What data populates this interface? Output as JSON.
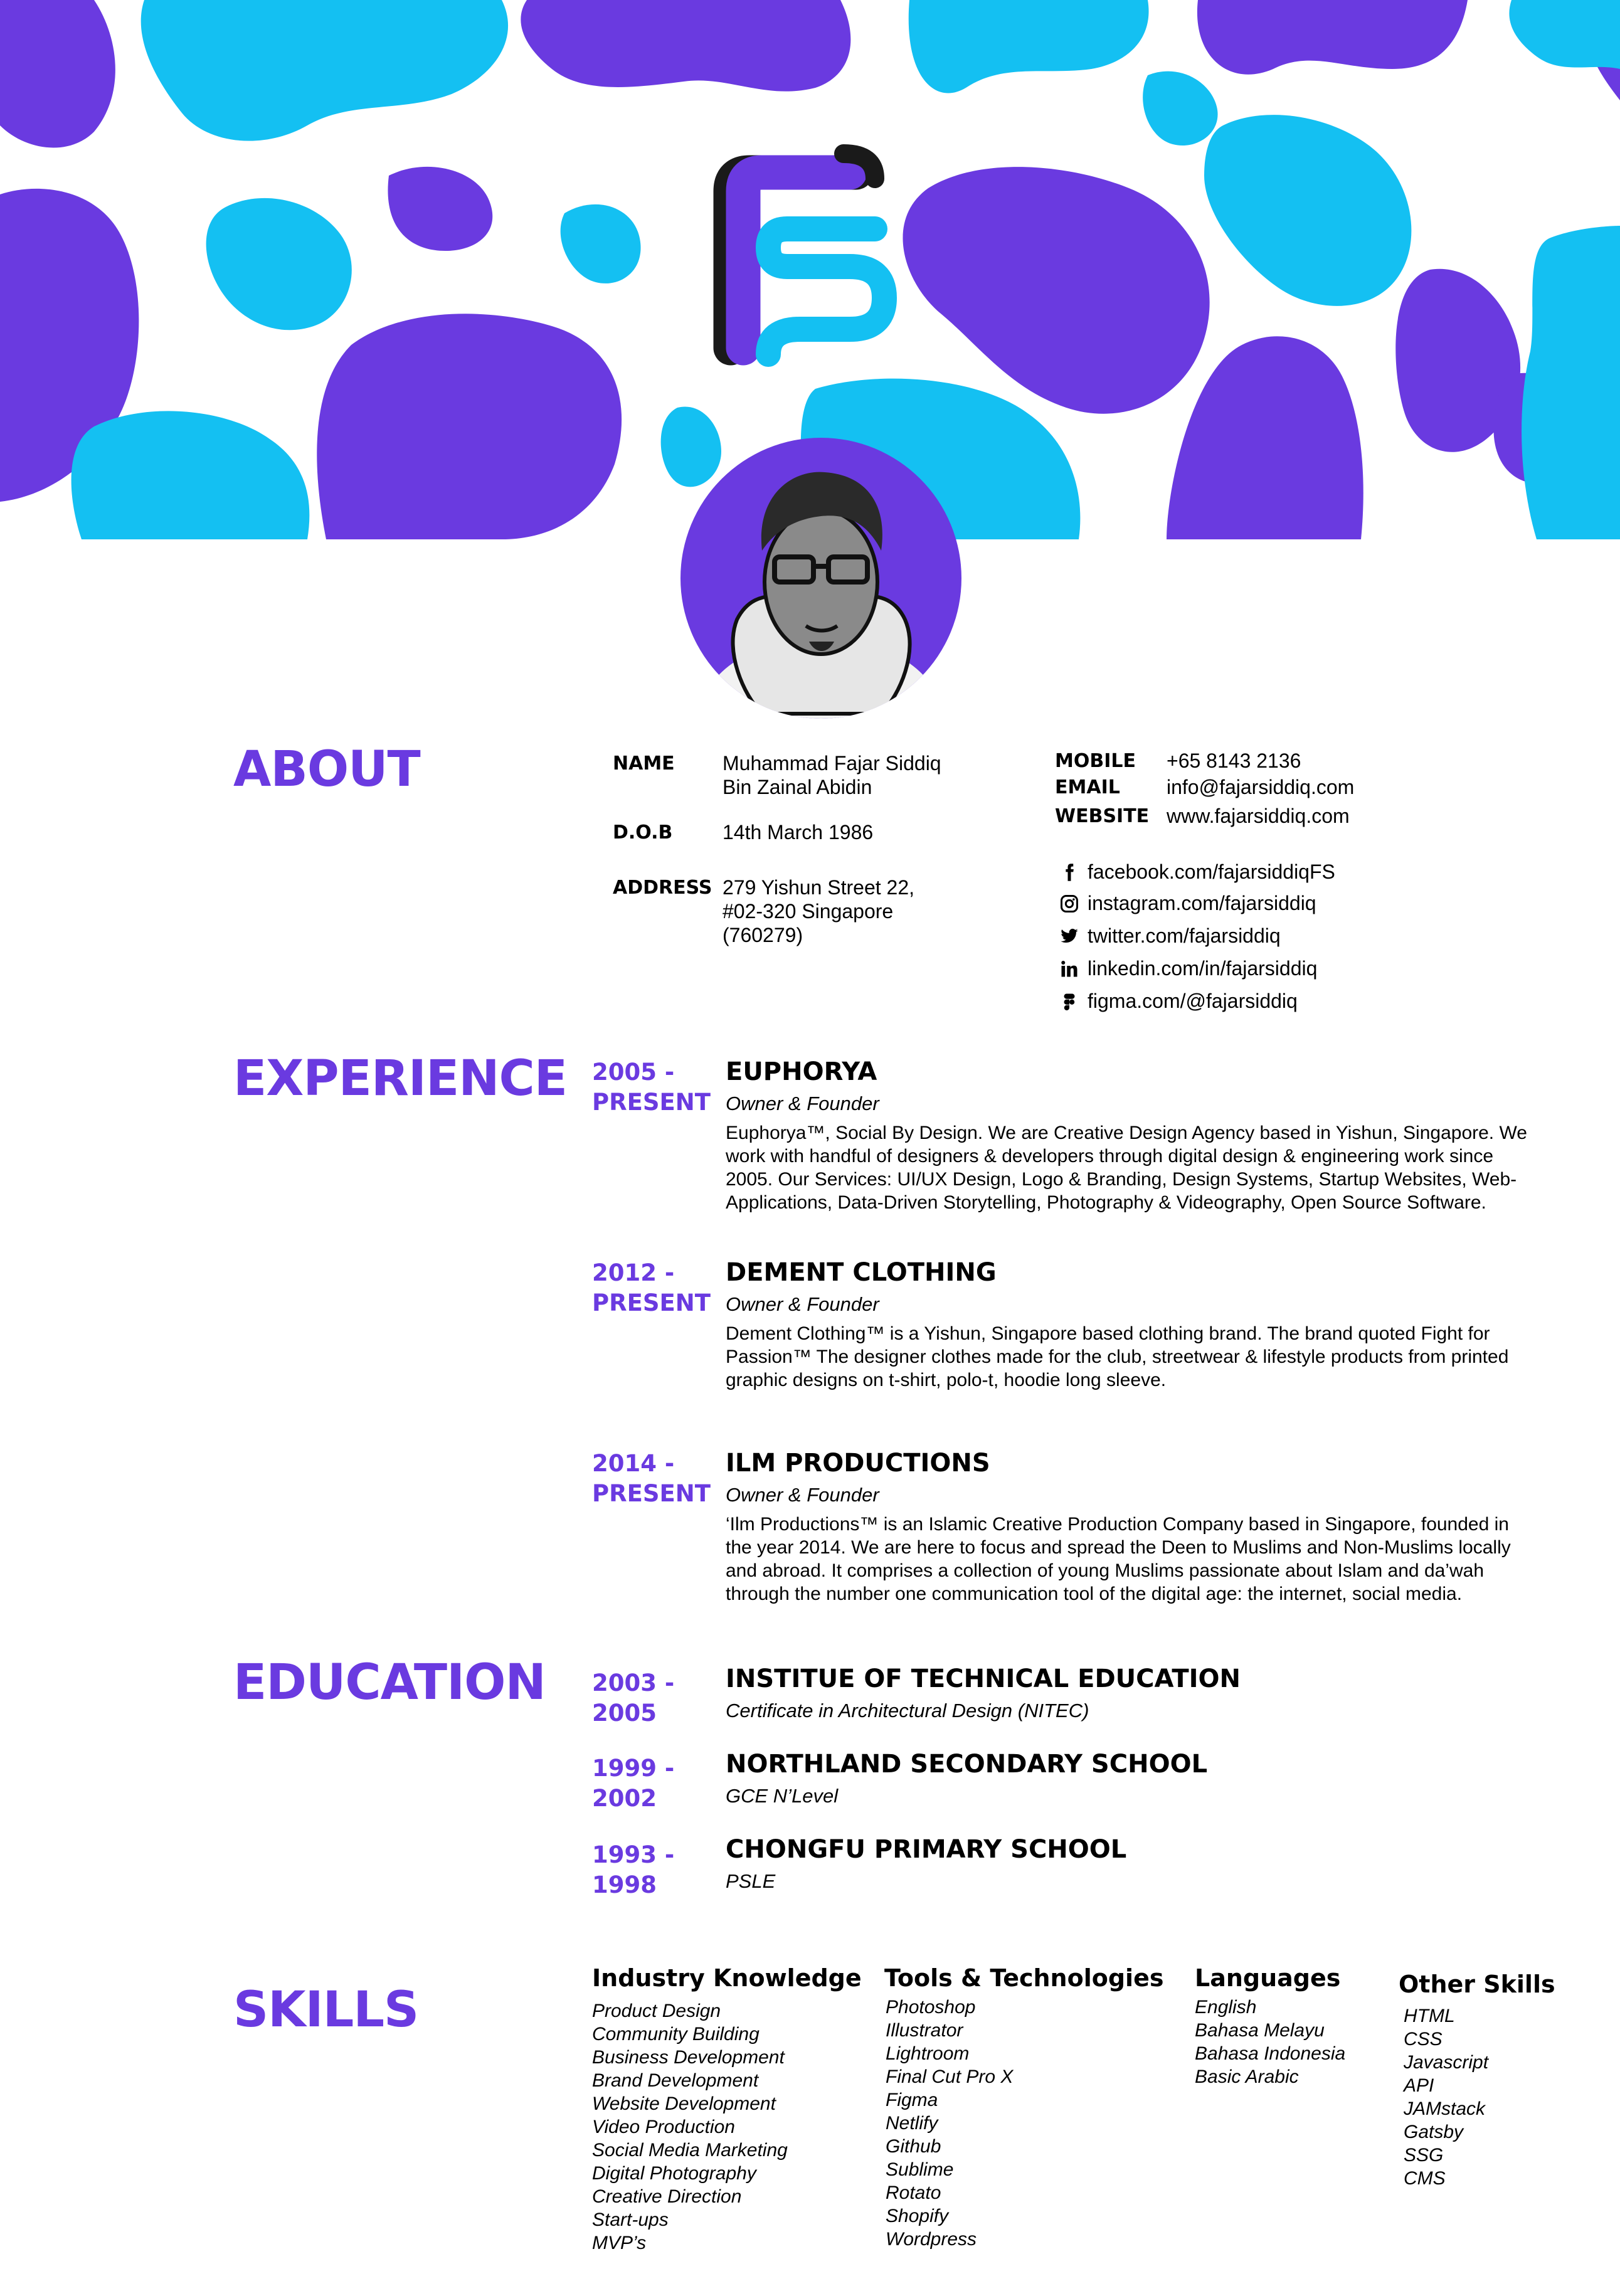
{
  "colors": {
    "purple": "#6a3ae0",
    "cyan": "#14c0f2",
    "text": "#000000"
  },
  "avatar": {
    "icon": "portrait-illustration"
  },
  "logo": {
    "icon": "fs-monogram-logo"
  },
  "about": {
    "heading": "ABOUT",
    "name_label": "NAME",
    "name_value": "Muhammad Fajar Siddiq\nBin Zainal Abidin",
    "dob_label": "D.O.B",
    "dob_value": "14th March 1986",
    "address_label": "ADDRESS",
    "address_value": "279 Yishun Street 22,\n#02-320 Singapore\n(760279)",
    "mobile_label": "MOBILE",
    "mobile_value": "+65 8143 2136",
    "email_label": "EMAIL",
    "email_value": "info@fajarsiddiq.com",
    "website_label": "WEBSITE",
    "website_value": "www.fajarsiddiq.com",
    "socials": [
      {
        "icon": "facebook-icon",
        "text": "facebook.com/fajarsiddiqFS"
      },
      {
        "icon": "instagram-icon",
        "text": "instagram.com/fajarsiddiq"
      },
      {
        "icon": "twitter-icon",
        "text": "twitter.com/fajarsiddiq"
      },
      {
        "icon": "linkedin-icon",
        "text": "linkedin.com/in/fajarsiddiq"
      },
      {
        "icon": "figma-icon",
        "text": "figma.com/@fajarsiddiq"
      }
    ]
  },
  "experience": {
    "heading": "EXPERIENCE",
    "items": [
      {
        "years": "2005 -\nPRESENT",
        "company": "EUPHORYA",
        "role": "Owner & Founder",
        "desc": "Euphorya™, Social By Design. We are Creative Design Agency based in Yishun, Singapore. We work with handful of designers & developers through digital design & engineering work since 2005. Our Services: UI/UX Design, Logo & Branding, Design Systems, Startup Websites, Web-Applications, Data-Driven Storytelling, Photography & Videography, Open Source Software."
      },
      {
        "years": "2012 -\nPRESENT",
        "company": "DEMENT CLOTHING",
        "role": "Owner & Founder",
        "desc": "Dement Clothing™ is a Yishun, Singapore based clothing brand. The brand quoted Fight for Passion™ The designer clothes made for the club, streetwear & lifestyle products from printed graphic designs on t-shirt, polo-t, hoodie long sleeve."
      },
      {
        "years": "2014 -\nPRESENT",
        "company": "ILM PRODUCTIONS",
        "role": "Owner & Founder",
        "desc": "‘Ilm Productions™ is an Islamic Creative Production Company based in Singapore, founded in the year 2014. We are here to focus and spread the Deen to Muslims and Non-Muslims locally and abroad. It comprises a collection of young Muslims passionate about Islam and da’wah through the number one communication tool of the digital age: the internet, social media."
      }
    ]
  },
  "education": {
    "heading": "EDUCATION",
    "items": [
      {
        "years": "2003 -\n2005",
        "school": "INSTITUE OF TECHNICAL EDUCATION",
        "detail": "Certificate in Architectural Design (NITEC)"
      },
      {
        "years": "1999 -\n2002",
        "school": "NORTHLAND SECONDARY SCHOOL",
        "detail": "GCE N’Level"
      },
      {
        "years": "1993 -\n1998",
        "school": "CHONGFU PRIMARY SCHOOL",
        "detail": "PSLE"
      }
    ]
  },
  "skills": {
    "heading": "SKILLS",
    "columns": [
      {
        "title": "Industry Knowledge",
        "items": [
          "Product Design",
          "Community Building",
          "Business Development",
          "Brand Development",
          "Website Development",
          "Video Production",
          "Social Media Marketing",
          "Digital Photography",
          "Creative Direction",
          "Start-ups",
          "MVP’s"
        ]
      },
      {
        "title": "Tools & Technologies",
        "items": [
          "Photoshop",
          "Illustrator",
          "Lightroom",
          "Final Cut Pro X",
          "Figma",
          "Netlify",
          "Github",
          "Sublime",
          "Rotato",
          "Shopify",
          "Wordpress"
        ]
      },
      {
        "title": "Languages",
        "items": [
          "English",
          "Bahasa Melayu",
          "Bahasa Indonesia",
          "Basic Arabic"
        ]
      },
      {
        "title": "Other Skills",
        "items": [
          "HTML",
          "CSS",
          "Javascript",
          "API",
          "JAMstack",
          "Gatsby",
          "SSG",
          "CMS"
        ]
      }
    ]
  }
}
